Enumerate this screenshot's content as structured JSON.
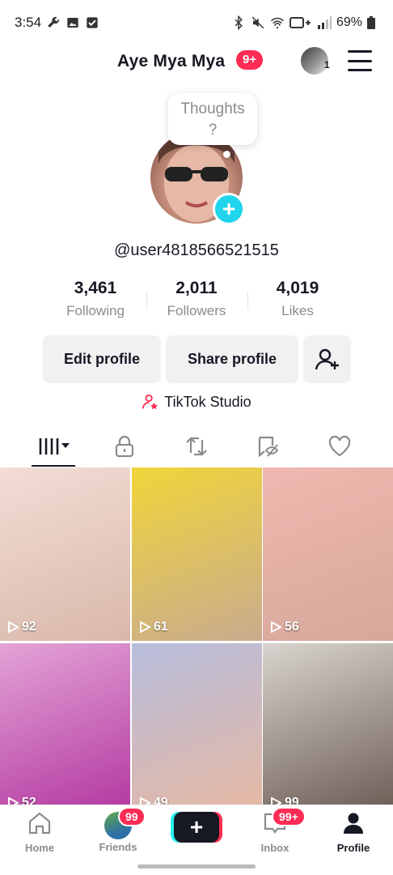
{
  "status_bar": {
    "time": "3:54",
    "battery": "69%"
  },
  "header": {
    "name": "Aye Mya Mya",
    "notif_badge": "9+",
    "switch_account_count": "1"
  },
  "avatar": {
    "thought_line1": "Thoughts",
    "thought_line2": "?"
  },
  "handle": "@user4818566521515",
  "stats": [
    {
      "value": "3,461",
      "label": "Following"
    },
    {
      "value": "2,011",
      "label": "Followers"
    },
    {
      "value": "4,019",
      "label": "Likes"
    }
  ],
  "buttons": {
    "edit": "Edit profile",
    "share": "Share profile"
  },
  "studio": "TikTok Studio",
  "videos": [
    {
      "views": "92",
      "color_a": "#d9b8aa",
      "color_b": "#f2ddd6"
    },
    {
      "views": "61",
      "color_a": "#c9ab8e",
      "color_b": "#f0d53a"
    },
    {
      "views": "56",
      "color_a": "#d6a89a",
      "color_b": "#f0b8b0"
    },
    {
      "views": "52",
      "color_a": "#b2369f",
      "color_b": "#e3a3d6"
    },
    {
      "views": "49",
      "color_a": "#e7b8a2",
      "color_b": "#b7bddc"
    },
    {
      "views": "99",
      "color_a": "#6a5a52",
      "color_b": "#d9d4cf"
    }
  ],
  "nav": {
    "home": "Home",
    "friends": "Friends",
    "friends_badge": "99",
    "inbox": "Inbox",
    "inbox_badge": "99+",
    "profile": "Profile"
  },
  "colors": {
    "accent": "#fe2c55",
    "cyan": "#20d5ec"
  }
}
